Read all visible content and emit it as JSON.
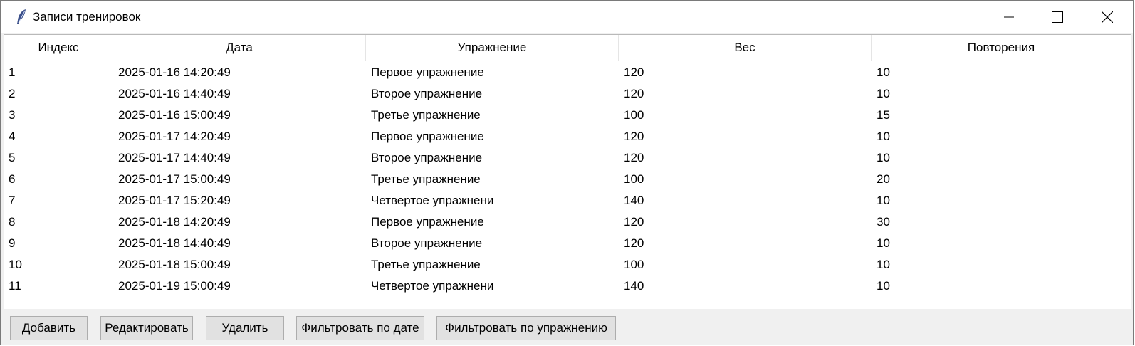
{
  "window": {
    "title": "Записи тренировок",
    "icon": "feather-icon"
  },
  "table": {
    "columns": [
      "Индекс",
      "Дата",
      "Упражнение",
      "Вес",
      "Повторения"
    ],
    "rows": [
      [
        "1",
        "2025-01-16 14:20:49",
        "Первое упражнение",
        "120",
        "10"
      ],
      [
        "2",
        "2025-01-16 14:40:49",
        "Второе упражнение",
        "120",
        "10"
      ],
      [
        "3",
        "2025-01-16 15:00:49",
        "Третье упражнение",
        "100",
        "15"
      ],
      [
        "4",
        "2025-01-17 14:20:49",
        "Первое упражнение",
        "120",
        "10"
      ],
      [
        "5",
        "2025-01-17 14:40:49",
        "Второе упражнение",
        "120",
        "10"
      ],
      [
        "6",
        "2025-01-17 15:00:49",
        "Третье упражнение",
        "100",
        "20"
      ],
      [
        "7",
        "2025-01-17 15:20:49",
        "Четвертое упражнени",
        "140",
        "10"
      ],
      [
        "8",
        "2025-01-18 14:20:49",
        "Первое упражнение",
        "120",
        "30"
      ],
      [
        "9",
        "2025-01-18 14:40:49",
        "Второе упражнение",
        "120",
        "10"
      ],
      [
        "10",
        "2025-01-18 15:00:49",
        "Третье упражнение",
        "100",
        "10"
      ],
      [
        "11",
        "2025-01-19 15:00:49",
        "Четвертое упражнени",
        "140",
        "10"
      ]
    ]
  },
  "buttons": {
    "add": "Добавить",
    "edit": "Редактировать",
    "delete": "Удалить",
    "filter_date": "Фильтровать по дате",
    "filter_exercise": "Фильтровать по упражнению"
  }
}
